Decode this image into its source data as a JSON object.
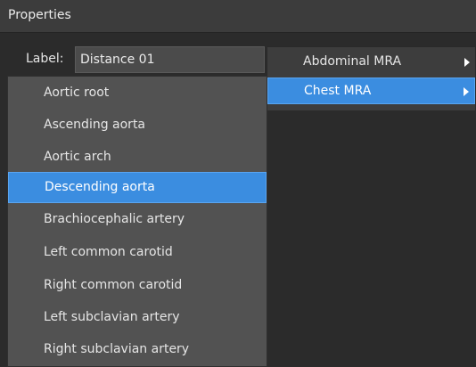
{
  "panel": {
    "title": "Properties"
  },
  "label_row": {
    "label": "Label:",
    "value": "Distance 01"
  },
  "submenu": {
    "items": [
      {
        "label": "Abdominal MRA",
        "has_submenu": true,
        "highlighted": false
      },
      {
        "label": "Chest MRA",
        "has_submenu": true,
        "highlighted": true
      }
    ]
  },
  "dropdown": {
    "items": [
      {
        "label": "Aortic root",
        "highlighted": false
      },
      {
        "label": "Ascending aorta",
        "highlighted": false
      },
      {
        "label": "Aortic arch",
        "highlighted": false
      },
      {
        "label": "Descending aorta",
        "highlighted": true
      },
      {
        "label": "Brachiocephalic artery",
        "highlighted": false
      },
      {
        "label": "Left common carotid",
        "highlighted": false
      },
      {
        "label": "Right common carotid",
        "highlighted": false
      },
      {
        "label": "Left subclavian artery",
        "highlighted": false
      },
      {
        "label": "Right subclavian artery",
        "highlighted": false
      }
    ]
  },
  "colors": {
    "background": "#2b2b2b",
    "highlight": "#3b8de0",
    "menu_background": "#525252",
    "text": "#e6e6e6"
  }
}
